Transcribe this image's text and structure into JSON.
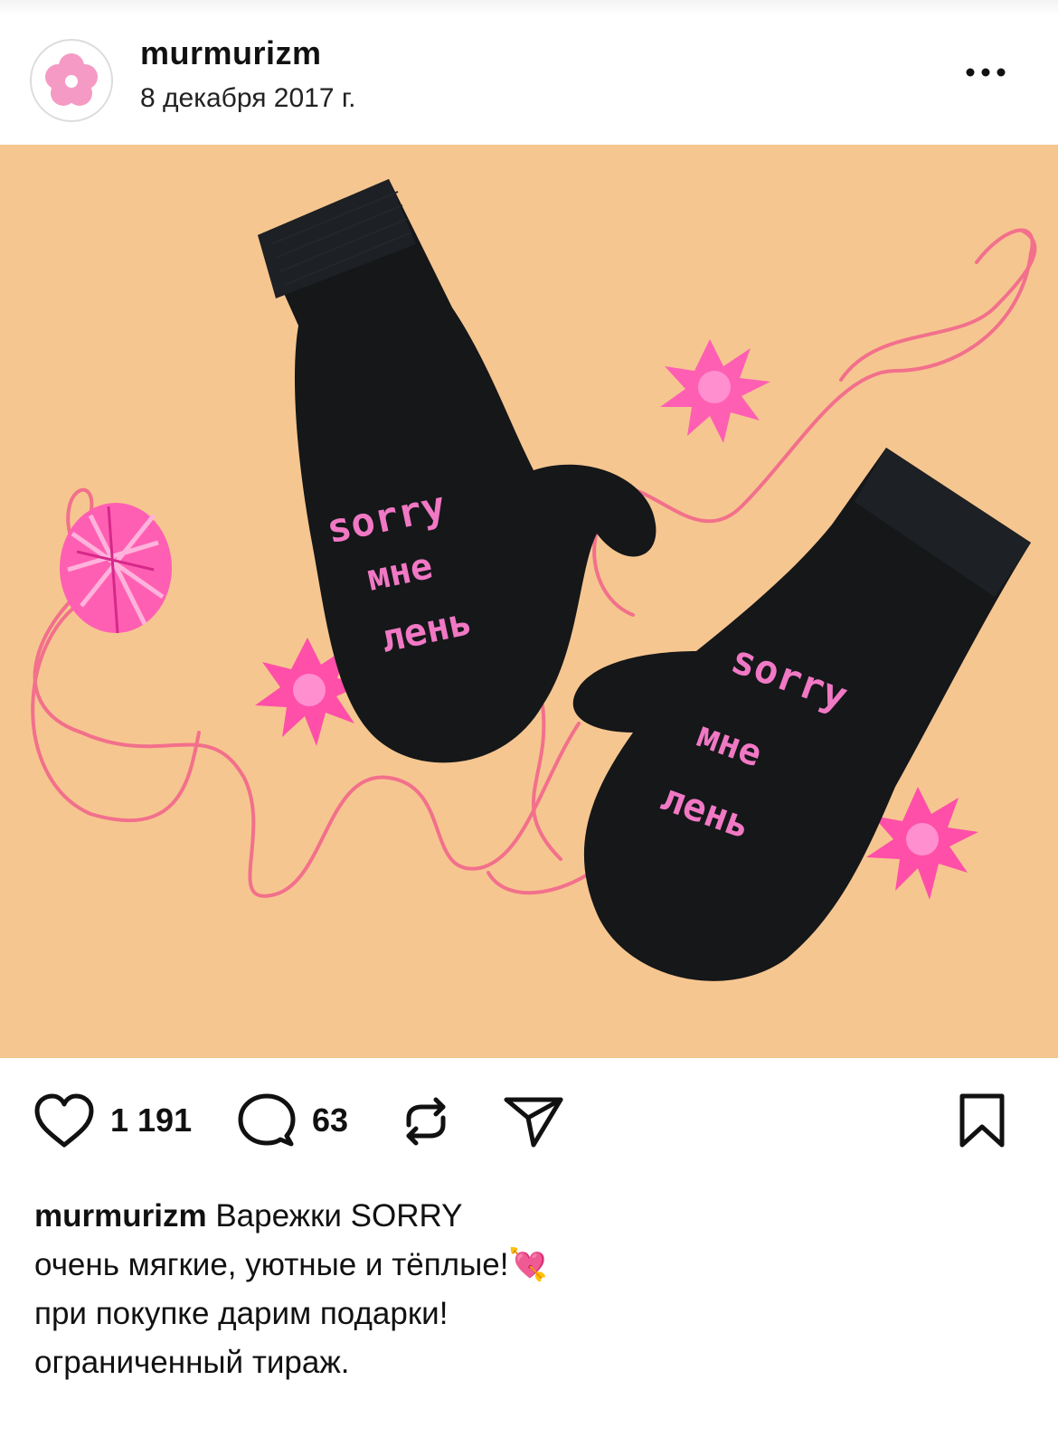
{
  "post": {
    "username": "murmurizm",
    "date": "8 декабря 2017 г.",
    "avatar_icon": "pink-flower-icon",
    "more_icon": "more-dots-icon"
  },
  "photo": {
    "background_color": "#f6c690",
    "mitten_color": "#151719",
    "knit_text_color": "#f178c4",
    "ribbon_color": "#f2708c",
    "bow_color": "#ff5fb3",
    "mitten_text": [
      "sorry",
      "мне",
      "лень"
    ]
  },
  "actions": {
    "like_icon": "heart-icon",
    "like_count": "1 191",
    "comment_icon": "comment-bubble-icon",
    "comment_count": "63",
    "repost_icon": "repost-arrows-icon",
    "share_icon": "send-plane-icon",
    "save_icon": "bookmark-icon"
  },
  "caption": {
    "username": "murmurizm",
    "line1": "Варежки SORRY",
    "line2": "очень мягкие, уютные и тёплые!",
    "line2_emoji": "💘",
    "line3": "при покупке дарим подарки!",
    "line4": "ограниченный тираж."
  }
}
